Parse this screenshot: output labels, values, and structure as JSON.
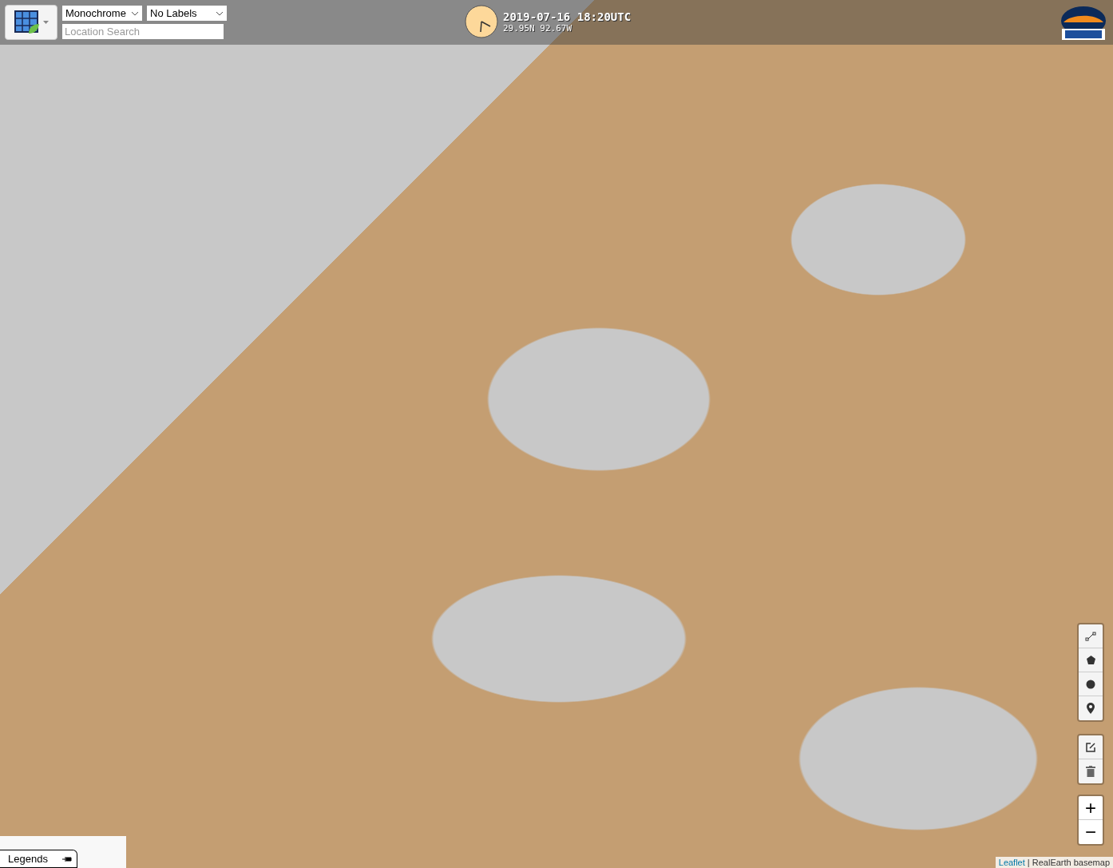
{
  "header": {
    "basemap": "Monochrome",
    "labels": "No Labels",
    "search": {
      "placeholder": "Location Search"
    },
    "datetime": "2019-07-16 18:20UTC",
    "coordinates": "29.95N 92.67W"
  },
  "draw_tools": [
    {
      "kind": "polyline"
    },
    {
      "kind": "polygon"
    },
    {
      "kind": "circle"
    },
    {
      "kind": "marker"
    }
  ],
  "edit_tools": [
    {
      "kind": "edit"
    },
    {
      "kind": "delete"
    }
  ],
  "zoom": [
    "+",
    "−"
  ],
  "legends": {
    "label": "Legends"
  },
  "attribution": {
    "link": "Leaflet",
    "text": "| RealEarth basemap"
  }
}
